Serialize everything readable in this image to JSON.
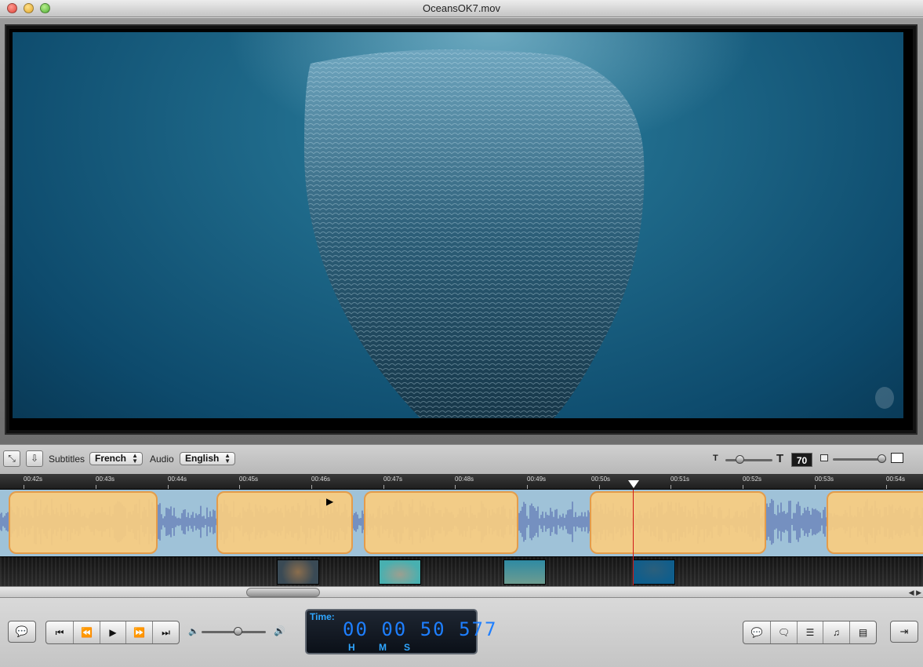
{
  "window": {
    "title": "OceansOK7.mov"
  },
  "toolbar": {
    "subtitles_label": "Subtitles",
    "subtitles_value": "French",
    "audio_label": "Audio",
    "audio_value": "English",
    "font_size_value": "70",
    "small_font_icon": "T",
    "large_font_icon": "T"
  },
  "timeline": {
    "ruler_labels": [
      "00:42s",
      "00:43s",
      "00:44s",
      "00:45s",
      "00:46s",
      "00:47s",
      "00:48s",
      "00:49s",
      "00:50s",
      "00:51s",
      "00:52s",
      "00:53s",
      "00:54s"
    ]
  },
  "time_display": {
    "label": "Time:",
    "hours": "00",
    "minutes": "00",
    "seconds": "50",
    "millis": "577",
    "unit_h": "H",
    "unit_m": "M",
    "unit_s": "S"
  },
  "icons": {
    "fullscreen": "expand-icon",
    "export": "export-icon",
    "add_subtitle": "speech-bubble-plus-icon",
    "go_start": "skip-start-icon",
    "rewind": "rewind-icon",
    "play": "play-icon",
    "fast_forward": "fast-forward-icon",
    "go_end": "skip-end-icon",
    "volume_low": "speaker-low-icon",
    "volume_high": "speaker-high-icon"
  },
  "colors": {
    "subtitle_block": "#f8cd80",
    "audio_track": "#9fc2d8",
    "playhead": "#d01818",
    "time_digits": "#1e7fff"
  }
}
